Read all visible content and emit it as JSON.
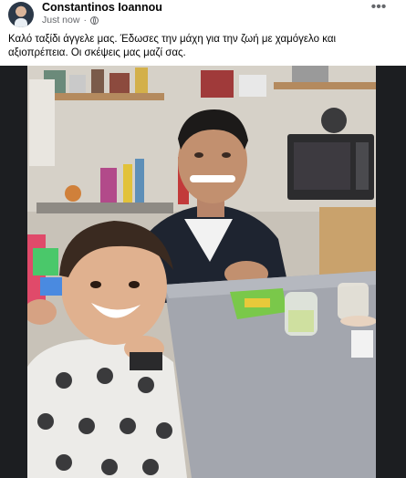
{
  "post": {
    "author_name": "Constantinos Ioannou",
    "timestamp": "Just now",
    "dot": "·",
    "privacy_icon": "globe-icon",
    "more_label": "•••",
    "caption": "Καλό ταξίδι άγγελε μας. Έδωσες την μάχη για την ζωή με χαμόγελο και αξιοπρέπεια. Οι σκέψεις μας μαζί σας."
  },
  "photo": {
    "icon": "photo"
  }
}
